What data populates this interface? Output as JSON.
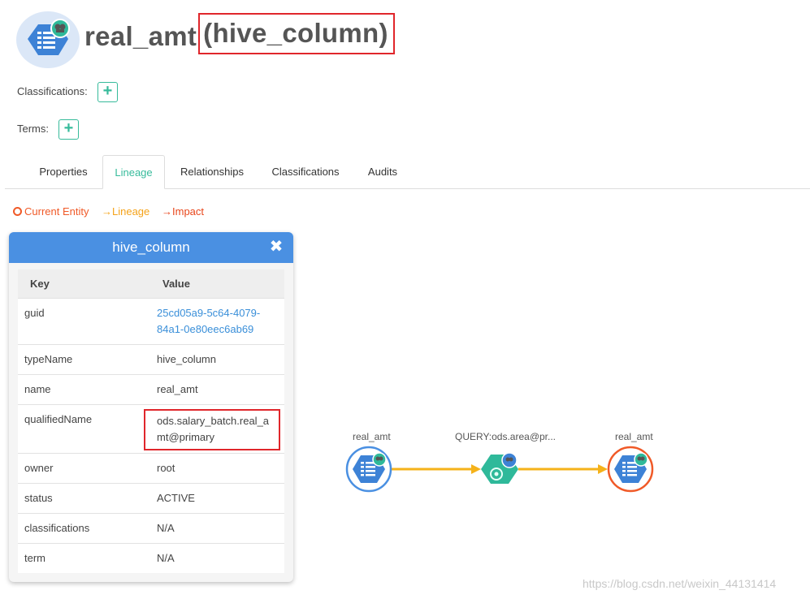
{
  "header": {
    "entity_name": "real_amt",
    "entity_type": "(hive_column)",
    "classifications_label": "Classifications:",
    "terms_label": "Terms:",
    "add_glyph": "+"
  },
  "tabs": [
    {
      "label": "Properties",
      "active": false
    },
    {
      "label": "Lineage",
      "active": true
    },
    {
      "label": "Relationships",
      "active": false
    },
    {
      "label": "Classifications",
      "active": false
    },
    {
      "label": "Audits",
      "active": false
    }
  ],
  "legend": {
    "current": "Current Entity",
    "lineage": "Lineage",
    "impact": "Impact",
    "arrow": "→"
  },
  "panel": {
    "title": "hive_column",
    "close_glyph": "✖",
    "columns": [
      "Key",
      "Value"
    ],
    "rows": [
      {
        "key": "guid",
        "value": "25cd05a9-5c64-4079-84a1-0e80eec6ab69",
        "line1": "25cd05a9-5c64-4079-",
        "line2": "84a1-0e80eec6ab69"
      },
      {
        "key": "typeName",
        "value": "hive_column"
      },
      {
        "key": "name",
        "value": "real_amt"
      },
      {
        "key": "qualifiedName",
        "value": "ods.salary_batch.real_amt@primary",
        "line1": "ods.salary_batch.real_a",
        "line2": "mt@primary"
      },
      {
        "key": "owner",
        "value": "root"
      },
      {
        "key": "status",
        "value": "ACTIVE"
      },
      {
        "key": "classifications",
        "value": "N/A"
      },
      {
        "key": "term",
        "value": "N/A"
      }
    ]
  },
  "lineage": {
    "nodes": [
      {
        "label": "real_amt",
        "role": "lineage"
      },
      {
        "label": "QUERY:ods.area@pr...",
        "role": "process"
      },
      {
        "label": "real_amt",
        "role": "current"
      }
    ]
  },
  "colors": {
    "accent": "#37bb9b",
    "panel_header": "#4a90e2",
    "lineage_edge": "#f5b21a",
    "impact": "#f05a28",
    "highlight_box": "#e0262b",
    "entity_blue": "#3d82d6",
    "process_green": "#2fb99a"
  },
  "watermark": "https://blog.csdn.net/weixin_44131414"
}
